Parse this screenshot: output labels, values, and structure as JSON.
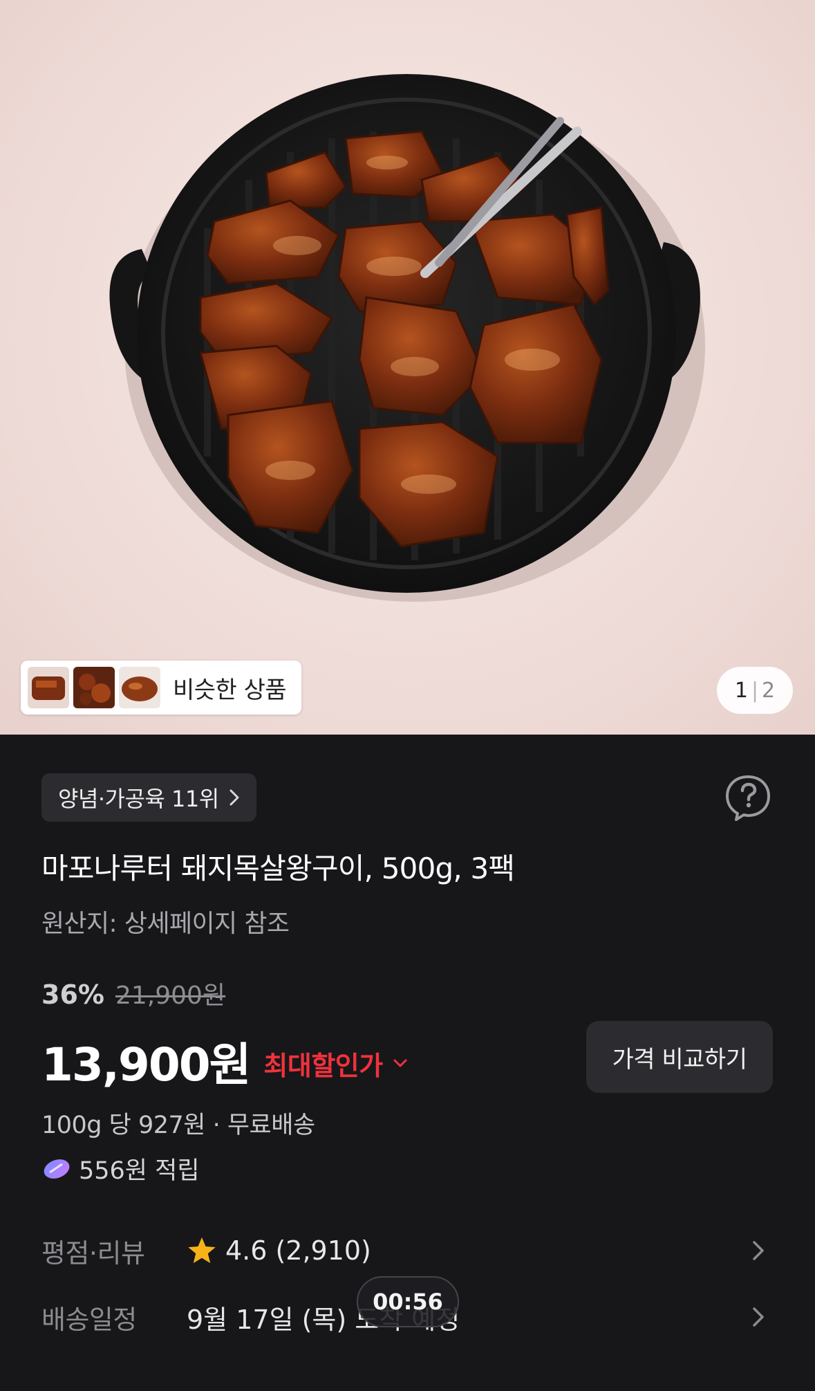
{
  "hero": {
    "similar_label": "비슷한 상품",
    "pager": {
      "current": "1",
      "separator": "|",
      "total": "2"
    }
  },
  "product": {
    "rank_label": "양념·가공육 11위",
    "title": "마포나루터 돼지목살왕구이, 500g, 3팩",
    "origin": "원산지: 상세페이지 참조",
    "discount_percent": "36%",
    "original_price": "21,900원",
    "price": "13,900원",
    "max_discount_label": "최대할인가",
    "compare_button": "가격 비교하기",
    "unit_price": "100g 당 927원 · 무료배송",
    "points": "556원 적립"
  },
  "rating": {
    "label": "평점·리뷰",
    "score": "4.6",
    "count": "(2,910)"
  },
  "delivery": {
    "label": "배송일정",
    "value": "9월 17일 (목) 도착 예정"
  },
  "overlay": {
    "timer": "00:56"
  },
  "colors": {
    "accent_red": "#f0323c",
    "panel_bg": "#17171a",
    "chip_bg": "#2c2c30",
    "star": "#f7b21a"
  },
  "icons": [
    "question-circle-icon",
    "chevron-right-icon",
    "chevron-down-icon",
    "star-icon",
    "coin-icon"
  ]
}
